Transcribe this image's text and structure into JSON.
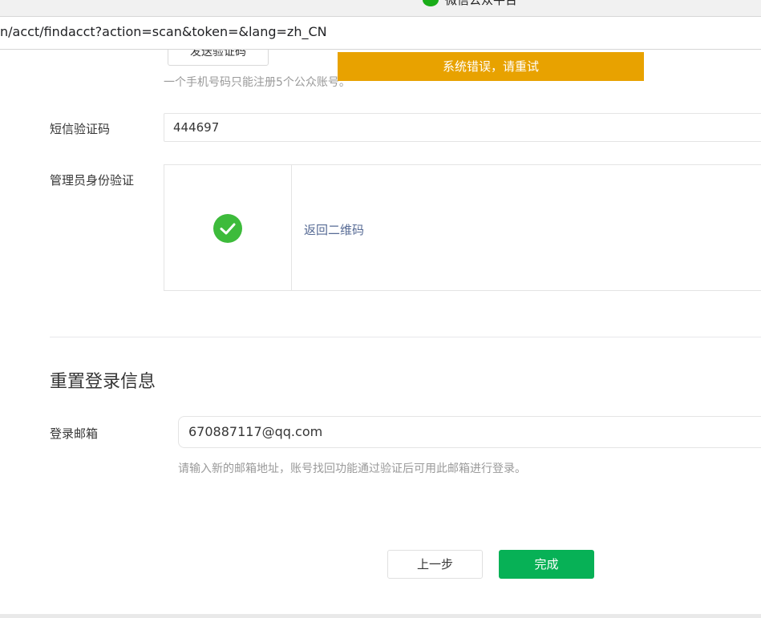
{
  "browser": {
    "tab_title": "微信公众平台",
    "url": "n/acct/findacct?action=scan&token=&lang=zh_CN"
  },
  "phone": {
    "send_code_label": "发送验证码",
    "tip": "一个手机号码只能注册5个公众账号。"
  },
  "toast": {
    "message": "系统错误，请重试",
    "color": "#e8a200"
  },
  "sms": {
    "label": "短信验证码",
    "value": "444697"
  },
  "admin_verify": {
    "label": "管理员身份验证",
    "status_icon": "check-circle-icon",
    "back_link": "返回二维码",
    "success_color": "#3dbb3b"
  },
  "reset_section": {
    "title": "重置登录信息",
    "email_label": "登录邮箱",
    "email_value": "670887117@qq.com",
    "email_tip": "请输入新的邮箱地址，账号找回功能通过验证后可用此邮箱进行登录。"
  },
  "actions": {
    "prev_label": "上一步",
    "done_label": "完成",
    "primary_color": "#07b156"
  }
}
